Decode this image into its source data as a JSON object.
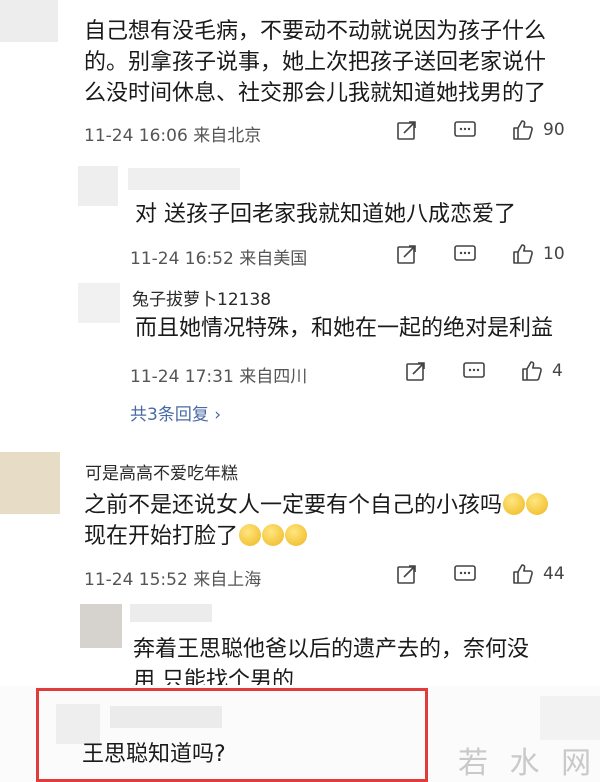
{
  "comments": [
    {
      "text_lines": [
        "自己想有没毛病，不要动不动就说因为孩子什么",
        "的。别拿孩子说事，她上次把孩子送回老家说什",
        "么没时间休息、社交那会儿我就知道她找男的了"
      ],
      "meta": "11-24 16:06 来自北京",
      "likes": "90"
    },
    {
      "text": "对 送孩子回老家我就知道她八成恋爱了",
      "meta": "11-24 16:52 来自美国",
      "likes": "10"
    },
    {
      "name": "兔子拔萝卜12138",
      "text": "而且她情况特殊，和她在一起的绝对是利益",
      "meta": "11-24 17:31 来自四川",
      "likes": "4"
    },
    {
      "name": "可是高高不爱吃年糕",
      "text_line1": "之前不是还说女人一定要有个自己的小孩吗",
      "text_line2": "现在开始打脸了",
      "meta": "11-24 15:52 来自上海",
      "likes": "44"
    },
    {
      "text_line1": "奔着王思聪他爸以后的遗产去的，奈何没",
      "text_line2": "用 只能找个男的"
    },
    {
      "text": "王思聪知道吗?"
    }
  ],
  "replies_link": "共3条回复 ›",
  "watermark": "若 水 网",
  "colors": {
    "highlight": "#e23b3b",
    "link": "#4a6aa5",
    "watermark": "#c9c9c9"
  },
  "icons": [
    "share-icon",
    "comment-icon",
    "like-icon",
    "chevron-right-icon"
  ]
}
